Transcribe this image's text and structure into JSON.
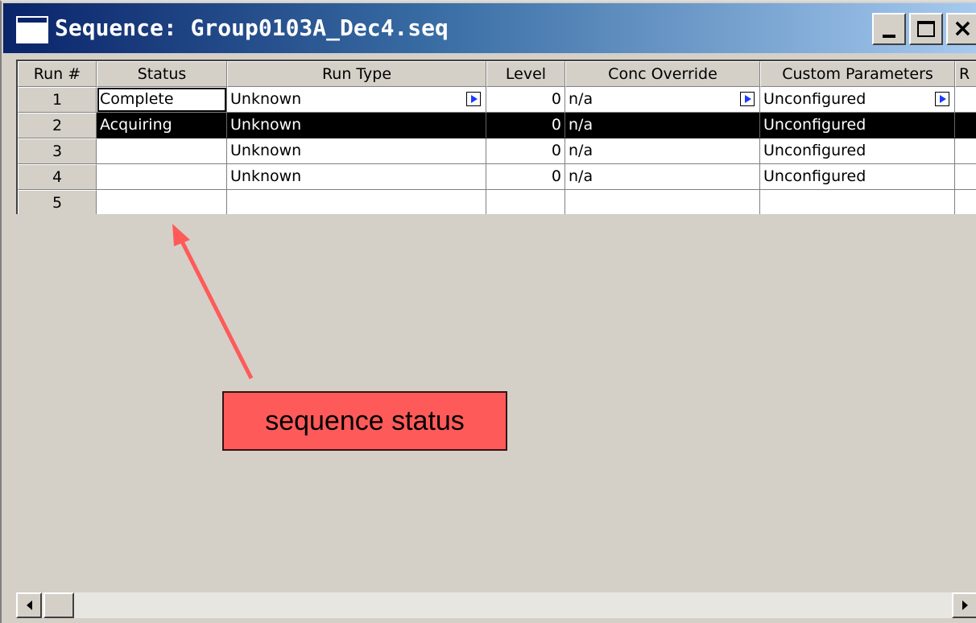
{
  "window": {
    "title": "Sequence: Group0103A_Dec4.seq"
  },
  "columns": [
    "Run #",
    "Status",
    "Run Type",
    "Level",
    "Conc Override",
    "Custom Parameters",
    "R"
  ],
  "rows": [
    {
      "run": "1",
      "status": "Complete",
      "run_type": "Unknown",
      "level": "0",
      "conc": "n/a",
      "custom": "Unconfigured"
    },
    {
      "run": "2",
      "status": "Acquiring",
      "run_type": "Unknown",
      "level": "0",
      "conc": "n/a",
      "custom": "Unconfigured"
    },
    {
      "run": "3",
      "status": "",
      "run_type": "Unknown",
      "level": "0",
      "conc": "n/a",
      "custom": "Unconfigured"
    },
    {
      "run": "4",
      "status": "",
      "run_type": "Unknown",
      "level": "0",
      "conc": "n/a",
      "custom": "Unconfigured"
    },
    {
      "run": "5",
      "status": "",
      "run_type": "",
      "level": "",
      "conc": "",
      "custom": ""
    }
  ],
  "annotation": {
    "label": "sequence status",
    "color": "#ff5a5a"
  },
  "colors": {
    "titlebar_start": "#0a246a",
    "selected_row": "#000000",
    "dropdown_arrow": "#1a3cff"
  },
  "icons": [
    "window-icon",
    "minimize-icon",
    "maximize-icon",
    "close-icon",
    "dropdown-arrow-icon",
    "scroll-left-icon",
    "scroll-right-icon"
  ]
}
